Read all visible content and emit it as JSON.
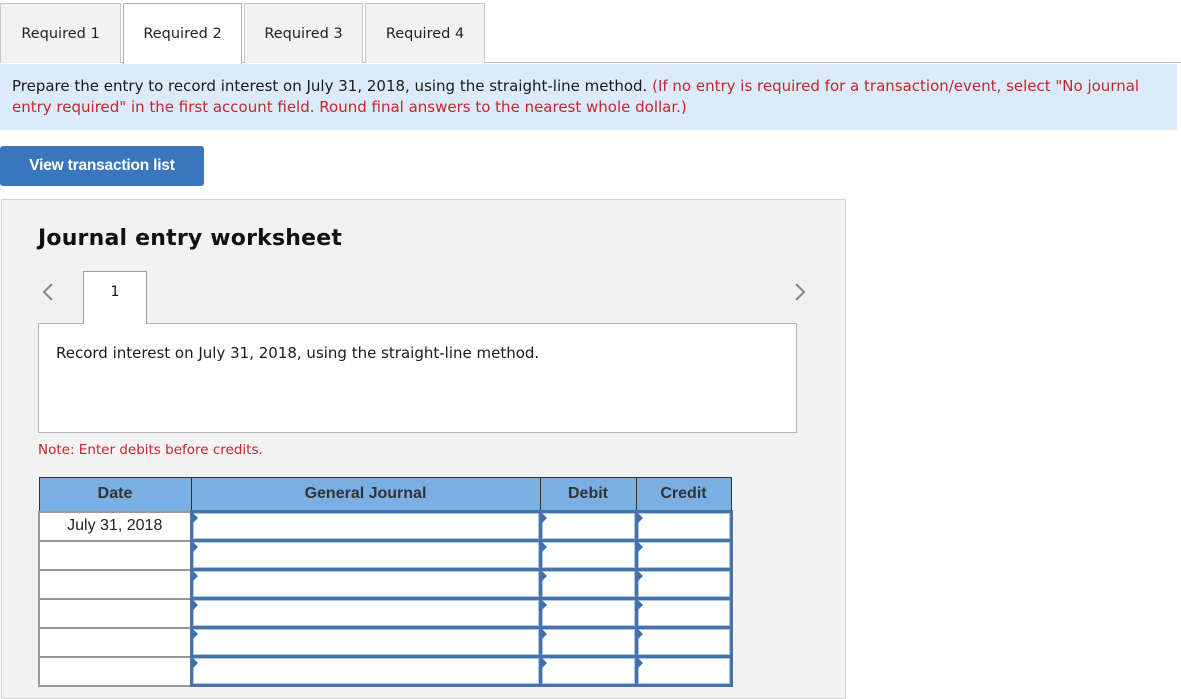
{
  "tabs": [
    {
      "label": "Required 1",
      "active": false
    },
    {
      "label": "Required 2",
      "active": true
    },
    {
      "label": "Required 3",
      "active": false
    },
    {
      "label": "Required 4",
      "active": false
    }
  ],
  "instructions": {
    "main": "Prepare the entry to record interest on July 31, 2018, using the straight-line method.",
    "note": "(If no entry is required for a transaction/event, select \"No journal entry required\" in the first account field. Round final answers to the nearest whole dollar.)"
  },
  "view_transaction_button": "View transaction list",
  "worksheet": {
    "title": "Journal entry worksheet",
    "prev_icon": "chevron-left-icon",
    "next_icon": "chevron-right-icon",
    "entry_tab": "1",
    "entry_description": "Record interest on July 31, 2018, using the straight-line method.",
    "note": "Note: Enter debits before credits.",
    "table": {
      "headers": [
        "Date",
        "General Journal",
        "Debit",
        "Credit"
      ],
      "rows": [
        {
          "date": "July 31, 2018",
          "account": "",
          "debit": "",
          "credit": ""
        },
        {
          "date": "",
          "account": "",
          "debit": "",
          "credit": ""
        },
        {
          "date": "",
          "account": "",
          "debit": "",
          "credit": ""
        },
        {
          "date": "",
          "account": "",
          "debit": "",
          "credit": ""
        },
        {
          "date": "",
          "account": "",
          "debit": "",
          "credit": ""
        },
        {
          "date": "",
          "account": "",
          "debit": "",
          "credit": ""
        }
      ]
    }
  }
}
